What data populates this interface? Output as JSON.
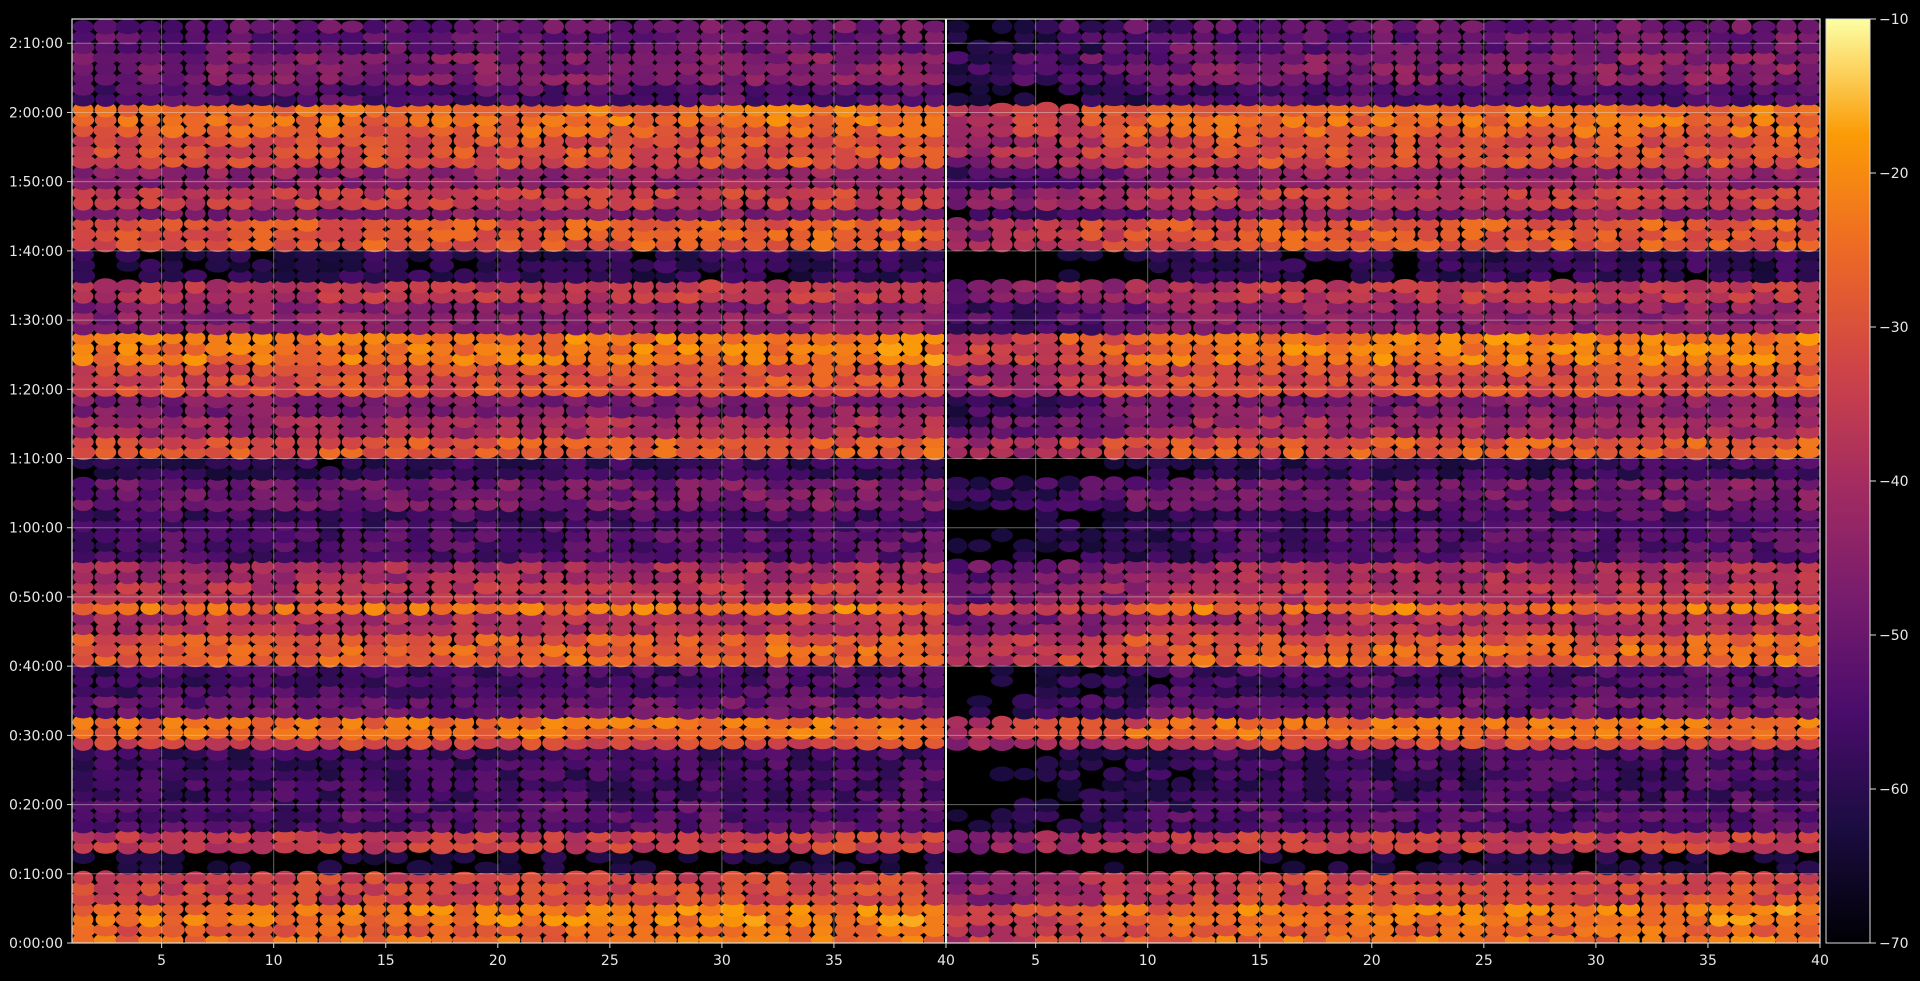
{
  "chart_data": {
    "type": "heatmap",
    "title": "",
    "xlabel": "",
    "ylabel": "",
    "panels": [
      {
        "name": "left",
        "xlim": [
          1,
          40
        ],
        "x_ticks": [
          5,
          10,
          15,
          20,
          25,
          30,
          35,
          40
        ]
      },
      {
        "name": "right",
        "xlim": [
          1,
          40
        ],
        "x_ticks": [
          5,
          10,
          15,
          20,
          25,
          30,
          35,
          40
        ]
      }
    ],
    "y_axis": {
      "unit": "elapsed time (h:mm:ss)",
      "ylim_minutes": [
        0,
        133.5
      ],
      "tick_minutes": [
        0,
        10,
        20,
        30,
        40,
        50,
        60,
        70,
        80,
        90,
        100,
        110,
        120,
        130
      ],
      "tick_labels": [
        "0:00:00",
        "0:10:00",
        "0:20:00",
        "0:30:00",
        "0:40:00",
        "0:50:00",
        "1:00:00",
        "1:10:00",
        "1:20:00",
        "1:30:00",
        "1:40:00",
        "1:50:00",
        "2:00:00",
        "2:10:00"
      ]
    },
    "colorbar": {
      "colormap": "inferno",
      "range": [
        -70,
        -10
      ],
      "ticks": [
        -10,
        -20,
        -30,
        -40,
        -50,
        -60,
        -70
      ],
      "tick_labels": [
        "−10",
        "−20",
        "−30",
        "−40",
        "−50",
        "−60",
        "−70"
      ]
    },
    "grid": true,
    "row_step_minutes": 1.5,
    "levels_by_time_band": [
      {
        "from": 0,
        "to": 1,
        "value": -26
      },
      {
        "from": 1,
        "to": 3,
        "value": -28
      },
      {
        "from": 3,
        "to": 5.5,
        "value": -24
      },
      {
        "from": 5.5,
        "to": 9.5,
        "value": -34
      },
      {
        "from": 9.5,
        "to": 13.5,
        "value": -66
      },
      {
        "from": 13.5,
        "to": 16.5,
        "value": -36
      },
      {
        "from": 16.5,
        "to": 21,
        "value": -55
      },
      {
        "from": 21,
        "to": 28,
        "value": -58
      },
      {
        "from": 28,
        "to": 29.5,
        "value": -34
      },
      {
        "from": 29.5,
        "to": 32.5,
        "value": -26
      },
      {
        "from": 32.5,
        "to": 35.5,
        "value": -52
      },
      {
        "from": 35.5,
        "to": 40.5,
        "value": -57
      },
      {
        "from": 40.5,
        "to": 42.5,
        "value": -28
      },
      {
        "from": 42.5,
        "to": 45,
        "value": -30
      },
      {
        "from": 45,
        "to": 47.5,
        "value": -40
      },
      {
        "from": 47.5,
        "to": 49.5,
        "value": -25
      },
      {
        "from": 49.5,
        "to": 52.5,
        "value": -38
      },
      {
        "from": 52.5,
        "to": 55.5,
        "value": -42
      },
      {
        "from": 55.5,
        "to": 60,
        "value": -55
      },
      {
        "from": 60,
        "to": 62.5,
        "value": -57
      },
      {
        "from": 62.5,
        "to": 66.5,
        "value": -50
      },
      {
        "from": 66.5,
        "to": 70.5,
        "value": -60
      },
      {
        "from": 70.5,
        "to": 72.5,
        "value": -30
      },
      {
        "from": 72.5,
        "to": 75.5,
        "value": -42
      },
      {
        "from": 75.5,
        "to": 79.5,
        "value": -48
      },
      {
        "from": 79.5,
        "to": 84,
        "value": -32
      },
      {
        "from": 84,
        "to": 88.5,
        "value": -24
      },
      {
        "from": 88.5,
        "to": 93,
        "value": -46
      },
      {
        "from": 93,
        "to": 96,
        "value": -38
      },
      {
        "from": 96,
        "to": 100.5,
        "value": -62
      },
      {
        "from": 100.5,
        "to": 104,
        "value": -30
      },
      {
        "from": 104,
        "to": 106.5,
        "value": -48
      },
      {
        "from": 106.5,
        "to": 109,
        "value": -36
      },
      {
        "from": 109,
        "to": 112.5,
        "value": -45
      },
      {
        "from": 112.5,
        "to": 116.5,
        "value": -32
      },
      {
        "from": 116.5,
        "to": 118.5,
        "value": -28
      },
      {
        "from": 118.5,
        "to": 121,
        "value": -26
      },
      {
        "from": 121,
        "to": 124.5,
        "value": -55
      },
      {
        "from": 124.5,
        "to": 128.5,
        "value": -48
      },
      {
        "from": 128.5,
        "to": 133.5,
        "value": -52
      }
    ],
    "right_panel_low_x_offset": -14,
    "right_panel_low_x_threshold": 12
  }
}
